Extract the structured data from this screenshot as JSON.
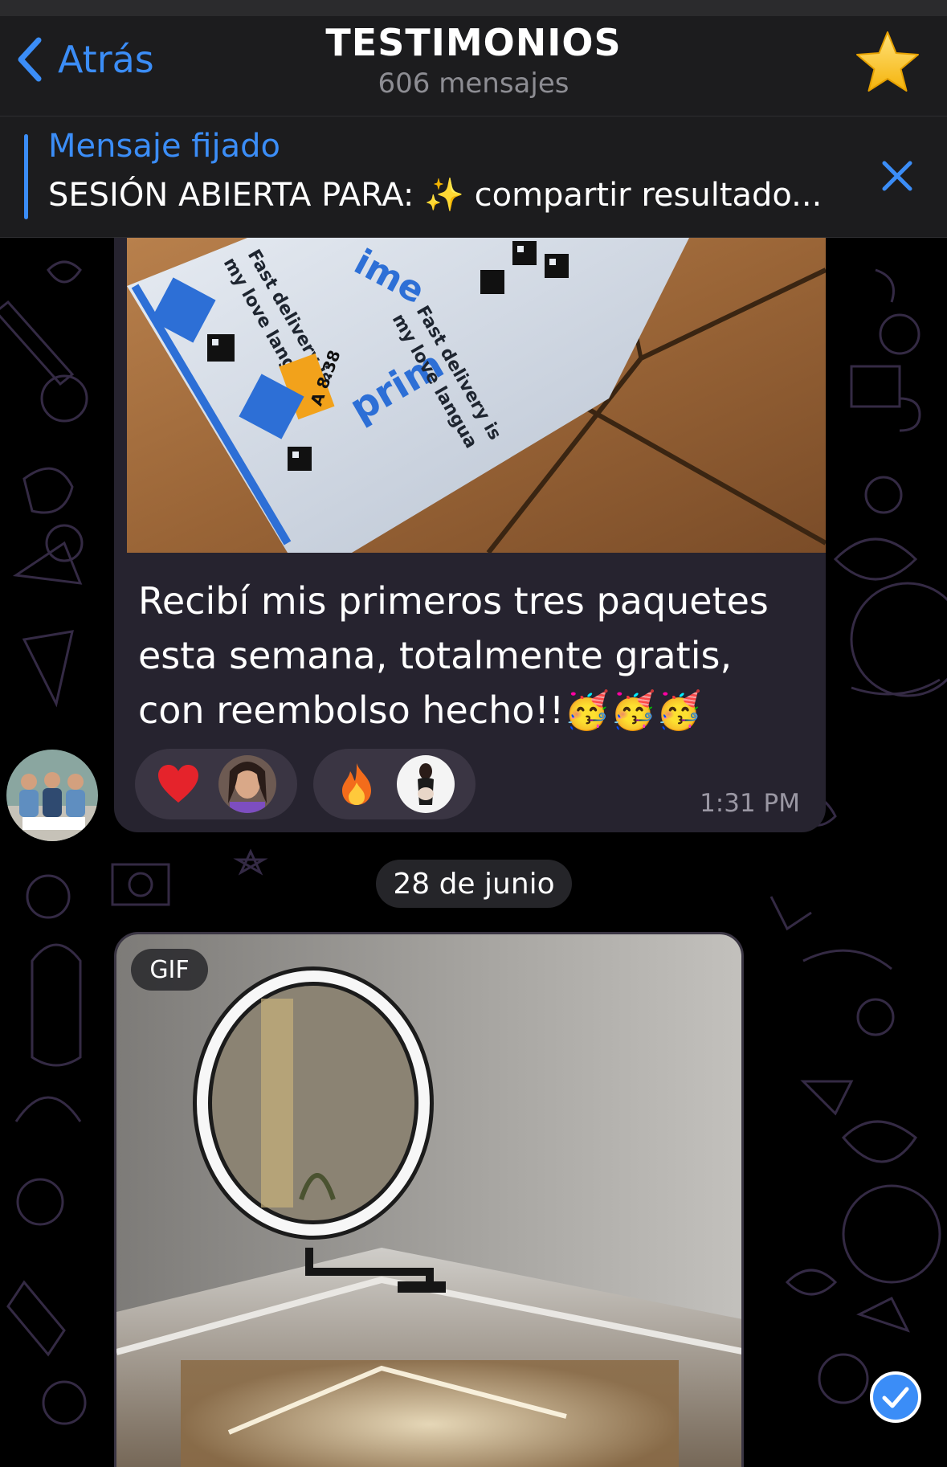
{
  "navbar": {
    "back_label": "Atrás",
    "title": "TESTIMONIOS",
    "subtitle": "606 mensajes",
    "star_icon": "star-icon"
  },
  "pinned": {
    "title": "Mensaje fijado",
    "text": "SESIÓN ABIERTA PARA: ✨ compartir resultado..."
  },
  "messages": [
    {
      "caption": "Recibí mis primeros tres paquetes esta semana, totalmente gratis, con reembolso hecho!!🥳🥳🥳",
      "time": "1:31 PM",
      "reactions": [
        {
          "emoji": "❤️"
        },
        {
          "emoji": "🔥"
        }
      ],
      "photo_text": {
        "line1": "Fast delivery is",
        "line2": "my love langua",
        "label": "prime",
        "tag": "A 8.38"
      }
    }
  ],
  "date_separator": "28 de junio",
  "gif": {
    "badge": "GIF"
  },
  "colors": {
    "accent": "#3b8df7",
    "bubble": "#26232f",
    "header": "#1c1c1e"
  }
}
